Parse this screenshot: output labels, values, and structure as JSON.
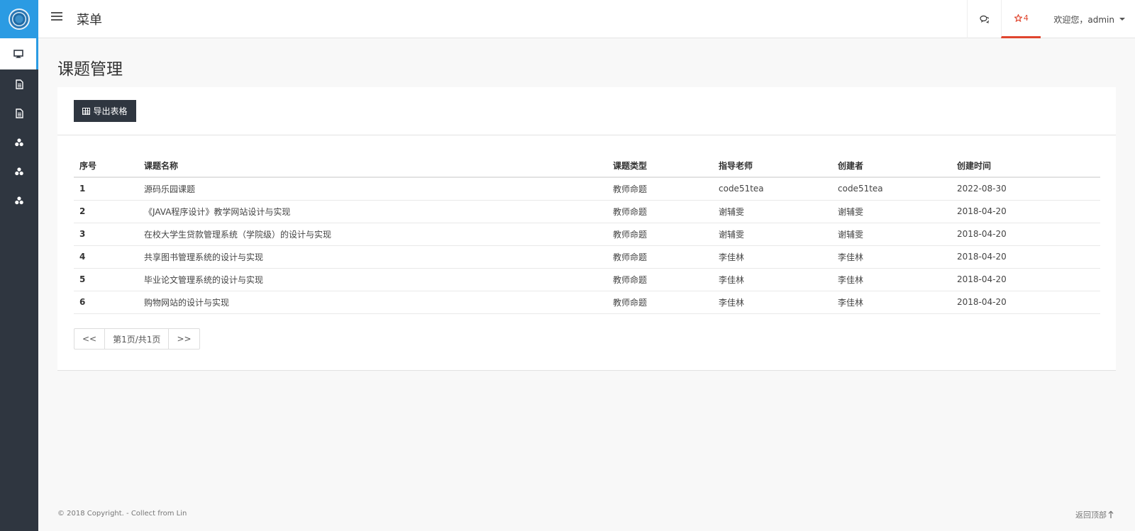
{
  "header": {
    "menu_title": "菜单",
    "star_count": "4",
    "user_greeting": "欢迎您，admin"
  },
  "sidebar": {
    "items": [
      {
        "icon": "monitor-icon",
        "active": true
      },
      {
        "icon": "document-icon"
      },
      {
        "icon": "document-icon"
      },
      {
        "icon": "cubes-icon"
      },
      {
        "icon": "cubes-icon"
      },
      {
        "icon": "cubes-icon"
      }
    ]
  },
  "main": {
    "title": "课题管理",
    "export_label": "导出表格",
    "table": {
      "headers": [
        "序号",
        "课题名称",
        "课题类型",
        "指导老师",
        "创建者",
        "创建时间"
      ],
      "rows": [
        [
          "1",
          "源码乐园课题",
          "教师命题",
          "code51tea",
          "code51tea",
          "2022-08-30"
        ],
        [
          "2",
          "《JAVA程序设计》教学网站设计与实现",
          "教师命题",
          "谢辅雯",
          "谢辅雯",
          "2018-04-20"
        ],
        [
          "3",
          "在校大学生贷款管理系统（学院级）的设计与实现",
          "教师命题",
          "谢辅雯",
          "谢辅雯",
          "2018-04-20"
        ],
        [
          "4",
          "共享图书管理系统的设计与实现",
          "教师命题",
          "李佳林",
          "李佳林",
          "2018-04-20"
        ],
        [
          "5",
          "毕业论文管理系统的设计与实现",
          "教师命题",
          "李佳林",
          "李佳林",
          "2018-04-20"
        ],
        [
          "6",
          "购物网站的设计与实现",
          "教师命题",
          "李佳林",
          "李佳林",
          "2018-04-20"
        ]
      ]
    },
    "pager": {
      "prev": "<<",
      "info": "第1页/共1页",
      "next": ">>"
    }
  },
  "footer": {
    "copyright": "© 2018 Copyright. - Collect from Lin",
    "back_to_top": "返回顶部"
  }
}
